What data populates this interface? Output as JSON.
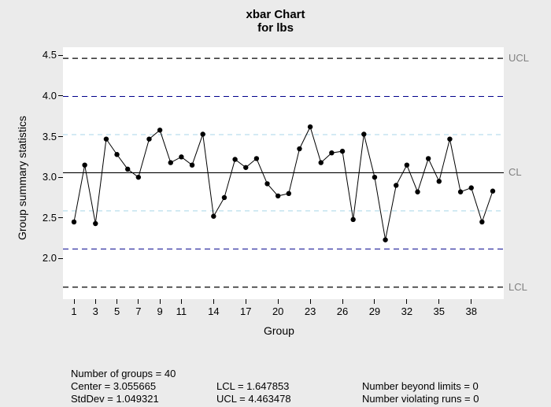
{
  "title_line1": "xbar Chart",
  "title_line2": "for lbs",
  "xlabel": "Group",
  "ylabel": "Group summary statistics",
  "rlabels": {
    "ucl": "UCL",
    "cl": "CL",
    "lcl": "LCL"
  },
  "footer": {
    "ngroups_lbl": "Number of groups = 40",
    "center_lbl": "Center = 3.055665",
    "stddev_lbl": "StdDev = 1.049321",
    "lcl_lbl": "LCL = 1.647853",
    "ucl_lbl": "UCL = 4.463478",
    "beyond_lbl": "Number beyond limits = 0",
    "violating_lbl": "Number violating runs = 0"
  },
  "chart_data": {
    "type": "line",
    "title": "xbar Chart for lbs",
    "xlabel": "Group",
    "ylabel": "Group summary statistics",
    "xlim": [
      1,
      40
    ],
    "ylim": [
      1.5,
      4.6
    ],
    "yticks": [
      2.0,
      2.5,
      3.0,
      3.5,
      4.0,
      4.5
    ],
    "xticks": [
      1,
      3,
      5,
      7,
      9,
      11,
      14,
      17,
      20,
      23,
      26,
      29,
      32,
      35,
      38
    ],
    "center": 3.055665,
    "ucl": 4.463478,
    "lcl": 1.647853,
    "stddev": 1.049321,
    "ngroups": 40,
    "beyond_limits": 0,
    "violating_runs": 0,
    "sigma_lines": {
      "plus2": 3.994,
      "plus1": 3.525,
      "minus1": 2.586,
      "minus2": 2.117
    },
    "x": [
      1,
      2,
      3,
      4,
      5,
      6,
      7,
      8,
      9,
      10,
      11,
      12,
      13,
      14,
      15,
      16,
      17,
      18,
      19,
      20,
      21,
      22,
      23,
      24,
      25,
      26,
      27,
      28,
      29,
      30,
      31,
      32,
      33,
      34,
      35,
      36,
      37,
      38,
      39,
      40
    ],
    "values": [
      2.45,
      3.15,
      2.43,
      3.47,
      3.28,
      3.1,
      3.0,
      3.47,
      3.58,
      3.18,
      3.25,
      3.15,
      3.53,
      2.52,
      2.75,
      3.22,
      3.12,
      3.23,
      2.92,
      2.77,
      2.8,
      3.35,
      3.62,
      3.18,
      3.3,
      3.32,
      2.48,
      3.53,
      3.0,
      2.23,
      2.9,
      3.15,
      2.82,
      3.23,
      2.95,
      3.47,
      2.82,
      2.87,
      2.45,
      2.83
    ]
  }
}
